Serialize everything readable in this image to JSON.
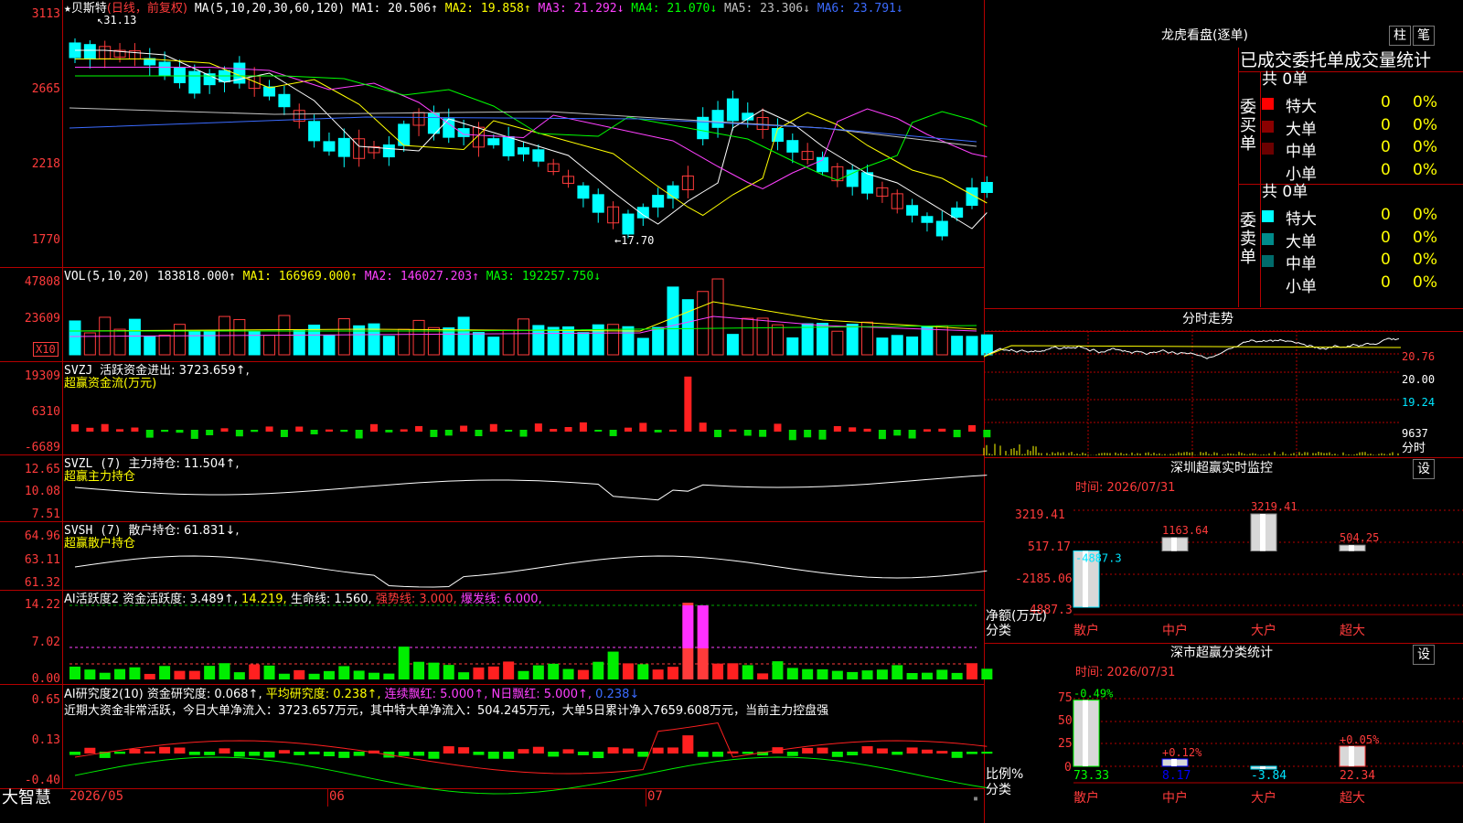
{
  "app": {
    "brand": "大智慧"
  },
  "main_chart": {
    "header": {
      "star": "★",
      "stock_name": "贝斯特",
      "period": "(日线，前复权)",
      "ma_def": "MA(5,10,20,30,60,120)",
      "ma1": "MA1: 20.506↑",
      "ma2": "MA2: 19.858↑",
      "ma3": "MA3: 21.292↓",
      "ma4": "MA4: 21.070↓",
      "ma5": "MA5: 23.306↓",
      "ma6": "MA6: 23.791↓"
    },
    "y_labels": [
      "3113",
      "2665",
      "2218",
      "1770"
    ],
    "high_label": "31.13",
    "low_label": "←17.70"
  },
  "vol_panel": {
    "header": {
      "def": "VOL(5,10,20)",
      "v": "183818.000↑",
      "ma1": "MA1: 166969.000↑",
      "ma2": "MA2: 146027.203↑",
      "ma3": "MA3: 192257.750↓"
    },
    "y_labels": [
      "47808",
      "23609"
    ],
    "unit": "X10"
  },
  "svzj_panel": {
    "header": {
      "def": "SVZJ",
      "title": "活跃资金进出: 3723.659↑,",
      "sub": "超赢资金流(万元)"
    },
    "y_labels": [
      "19309",
      "6310",
      "-6689"
    ]
  },
  "svzl_panel": {
    "header": {
      "def": "SVZL (7)",
      "title": "主力持仓: 11.504↑,",
      "sub": "超赢主力持仓"
    },
    "y_labels": [
      "12.65",
      "10.08",
      "7.51"
    ]
  },
  "svsh_panel": {
    "header": {
      "def": "SVSH (7)",
      "title": "散户持仓: 61.831↓,",
      "sub": "超赢散户持仓"
    },
    "y_labels": [
      "64.96",
      "63.11",
      "61.32"
    ]
  },
  "ai_active_panel": {
    "header": {
      "def": "AI活跃度2",
      "a": "资金活跃度: 3.489↑,",
      "b": "14.219,",
      "c": "生命线: 1.560,",
      "d": "强势线: 3.000,",
      "e": "爆发线: 6.000,"
    },
    "y_labels": [
      "14.22",
      "7.02",
      "0.00"
    ]
  },
  "ai_research_panel": {
    "header": {
      "def": "AI研究度2(10)",
      "a": "资金研究度: 0.068↑,",
      "b": "平均研究度: 0.238↑,",
      "c": "连续飘红: 5.000↑,",
      "d": "N日飘红: 5.000↑,",
      "e": "0.238↓"
    },
    "comment": "近期大资金非常活跃，今日大单净流入：3723.657万元，其中特大单净流入：504.245万元，大单5日累计净入7659.608万元，当前主力控盘强",
    "y_labels": [
      "0.65",
      "0.13",
      "-0.40"
    ]
  },
  "x_axis": {
    "labels": [
      "2026/05",
      "06",
      "07"
    ]
  },
  "dragon_tiger": {
    "title": "龙虎看盘(逐单)",
    "btn_bar": "柱",
    "btn_pen": "笔",
    "subtitle": "已成交委托单成交量统计",
    "buy": {
      "label": "委买单",
      "total": "共 0单",
      "rows": [
        {
          "name": "特大",
          "count": "0",
          "pct": "0%",
          "color": "#ff0000"
        },
        {
          "name": "大单",
          "count": "0",
          "pct": "0%",
          "color": "#8b0000"
        },
        {
          "name": "中单",
          "count": "0",
          "pct": "0%",
          "color": "#6b0000"
        },
        {
          "name": "小单",
          "count": "0",
          "pct": "0%",
          "color": "#000000"
        }
      ]
    },
    "sell": {
      "label": "委卖单",
      "total": "共 0单",
      "rows": [
        {
          "name": "特大",
          "count": "0",
          "pct": "0%",
          "color": "#00ffff"
        },
        {
          "name": "大单",
          "count": "0",
          "pct": "0%",
          "color": "#008b8b"
        },
        {
          "name": "中单",
          "count": "0",
          "pct": "0%",
          "color": "#006b6b"
        },
        {
          "name": "小单",
          "count": "0",
          "pct": "0%",
          "color": "#000000"
        }
      ]
    }
  },
  "intraday": {
    "title": "分时走势",
    "labels": [
      "20.76",
      "20.00",
      "19.24",
      "9637",
      "分时"
    ]
  },
  "sz_monitor": {
    "title": "深圳超赢实时监控",
    "btn": "设",
    "time": "时间: 2026/07/31",
    "y_labels": [
      "3219.41",
      "517.17",
      "-2185.06",
      "-4887.3"
    ],
    "axis_title": "净额(万元)",
    "axis_sub": "分类",
    "chart_data": {
      "type": "bar",
      "categories": [
        "散户",
        "中户",
        "大户",
        "超大"
      ],
      "values": [
        -4887.3,
        1163.64,
        3219.41,
        504.25
      ],
      "value_labels": [
        "-4887.3",
        "1163.64",
        "3219.41",
        "504.25"
      ],
      "ylabel": "净额(万元)",
      "ylim": [
        -4887.3,
        3219.41
      ]
    }
  },
  "sz_class": {
    "title": "深市超赢分类统计",
    "btn": "设",
    "time": "时间: 2026/07/31",
    "y_labels": [
      "75",
      "50",
      "25",
      "0"
    ],
    "axis_title": "比例%",
    "axis_sub": "分类",
    "chart_data": {
      "type": "bar",
      "categories": [
        "散户",
        "中户",
        "大户",
        "超大"
      ],
      "values": [
        73.33,
        8.17,
        -3.84,
        22.34
      ],
      "change_labels": [
        "-0.49%",
        "+0.12%",
        "",
        "+0.05%"
      ],
      "value_labels": [
        "73.33",
        "8.17",
        "-3.84",
        "22.34"
      ],
      "ylabel": "比例%",
      "ylim": [
        0,
        75
      ]
    }
  },
  "colors": {
    "up": "#ff3b3b",
    "down": "#00ffff",
    "grid": "#b40000"
  }
}
